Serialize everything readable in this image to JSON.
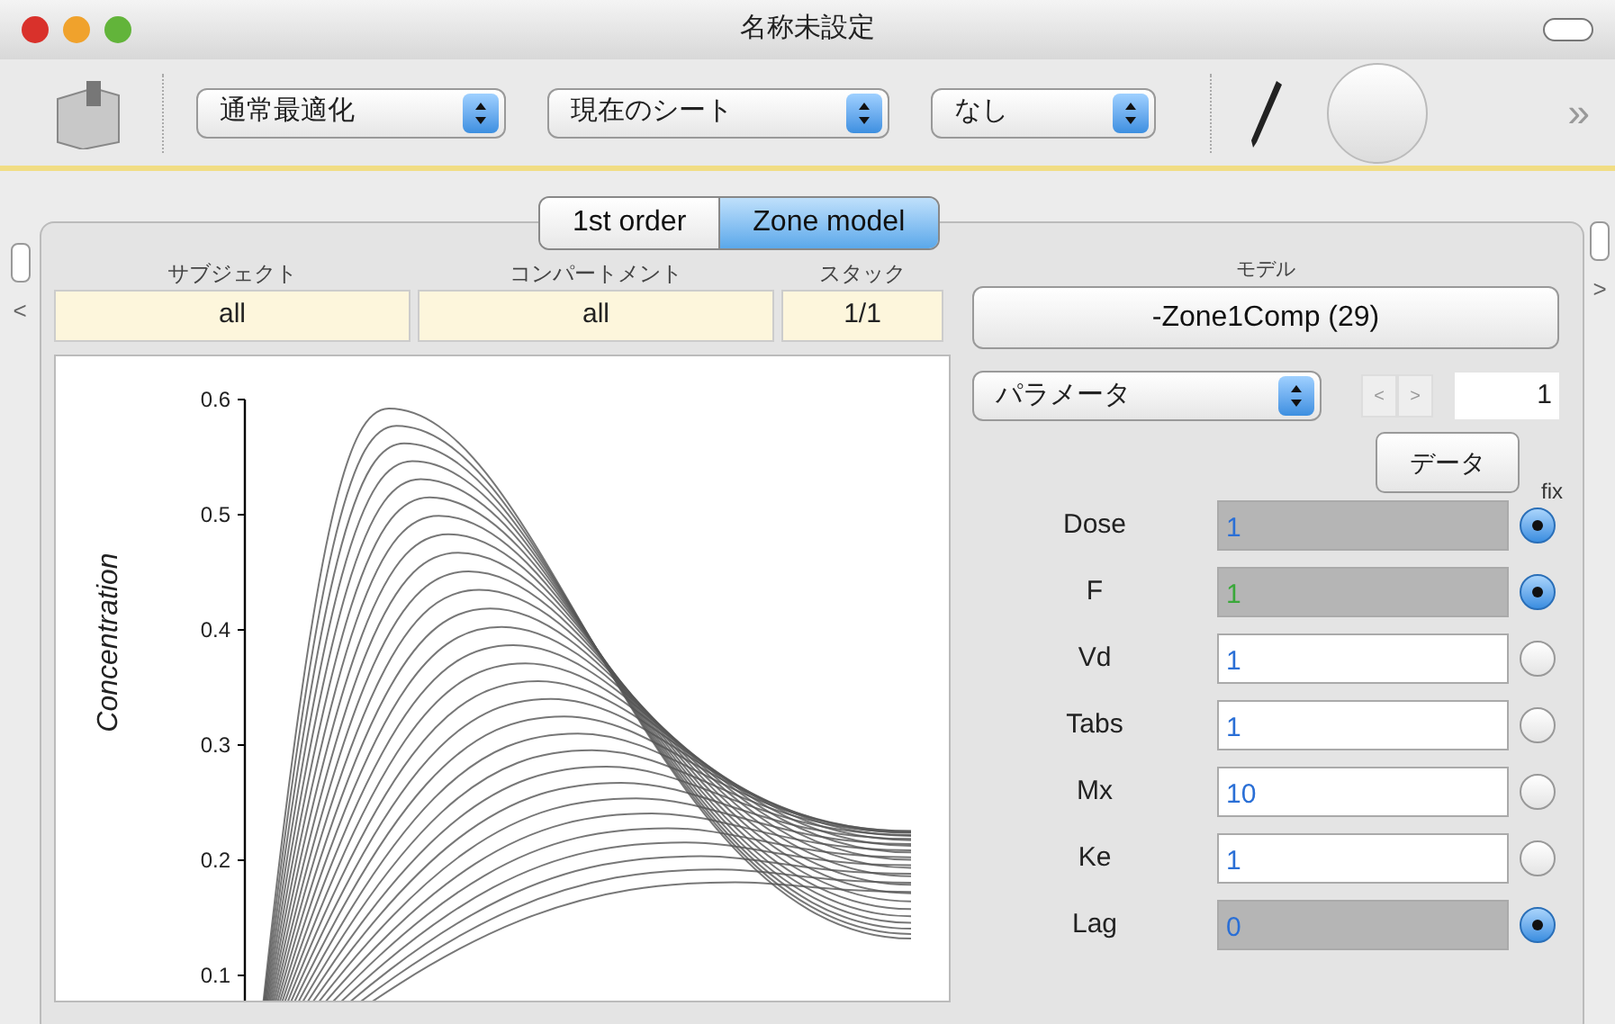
{
  "window": {
    "title": "名称未設定"
  },
  "toolbar": {
    "popups": [
      {
        "value": "通常最適化"
      },
      {
        "value": "現在のシート"
      },
      {
        "value": "なし"
      }
    ],
    "overflow": "»"
  },
  "tabs": [
    {
      "label": "1st order",
      "selected": false
    },
    {
      "label": "Zone model",
      "selected": true
    }
  ],
  "side_arrows": {
    "left": "<",
    "right": ">"
  },
  "selectors": [
    {
      "header": "サブジェクト",
      "value": "all"
    },
    {
      "header": "コンパートメント",
      "value": "all"
    },
    {
      "header": "スタック",
      "value": "1/1"
    }
  ],
  "plot": {
    "ylabel": "Concentration",
    "yticks": [
      "0.6",
      "0.5",
      "0.4",
      "0.3",
      "0.2",
      "0.1"
    ]
  },
  "model": {
    "header": "モデル",
    "button": "-Zone1Comp (29)"
  },
  "parameter_popup": {
    "value": "パラメータ"
  },
  "stepper": {
    "prev": "<",
    "next": ">",
    "index": "1"
  },
  "data_button": "データ",
  "fix_label": "fix",
  "parameters": [
    {
      "name": "Dose",
      "value": "1",
      "fixed": true,
      "color": "#2a6fd6"
    },
    {
      "name": "F",
      "value": "1",
      "fixed": true,
      "color": "#3aa83a"
    },
    {
      "name": "Vd",
      "value": "1",
      "fixed": false,
      "color": "#2a6fd6"
    },
    {
      "name": "Tabs",
      "value": "1",
      "fixed": false,
      "color": "#2a6fd6"
    },
    {
      "name": "Mx",
      "value": "10",
      "fixed": false,
      "color": "#2a6fd6"
    },
    {
      "name": "Ke",
      "value": "1",
      "fixed": false,
      "color": "#2a6fd6"
    },
    {
      "name": "Lag",
      "value": "0",
      "fixed": true,
      "color": "#2a6fd6"
    }
  ]
}
